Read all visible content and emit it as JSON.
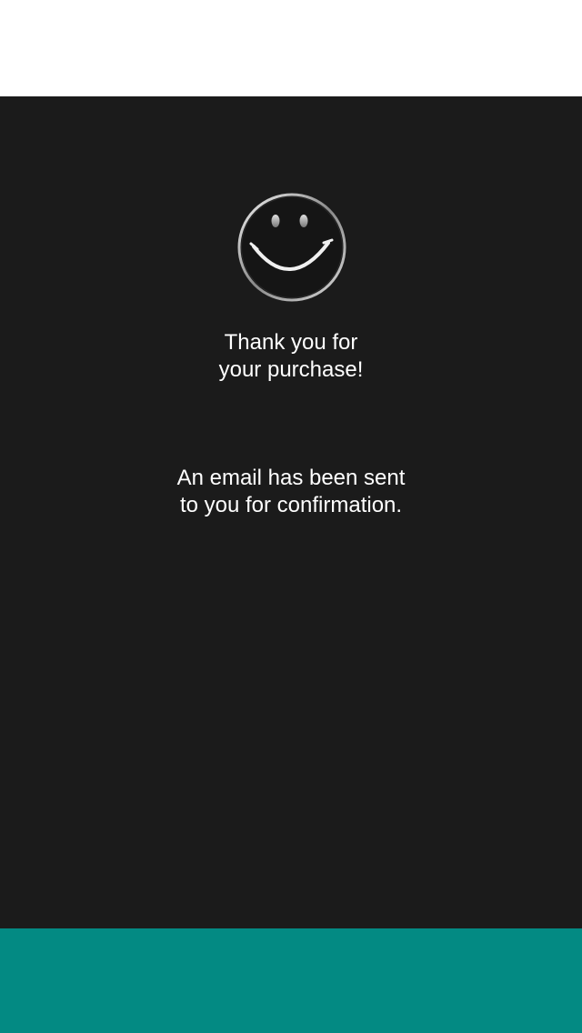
{
  "confirmation": {
    "title_line1": "Thank you for",
    "title_line2": "your purchase!",
    "message_line1": "An email has been sent",
    "message_line2": "to you for confirmation."
  },
  "icons": {
    "smiley": "smiley-face-icon"
  },
  "colors": {
    "background": "#1b1b1b",
    "top_bar": "#ffffff",
    "bottom_bar": "#038a83",
    "text": "#ffffff"
  }
}
